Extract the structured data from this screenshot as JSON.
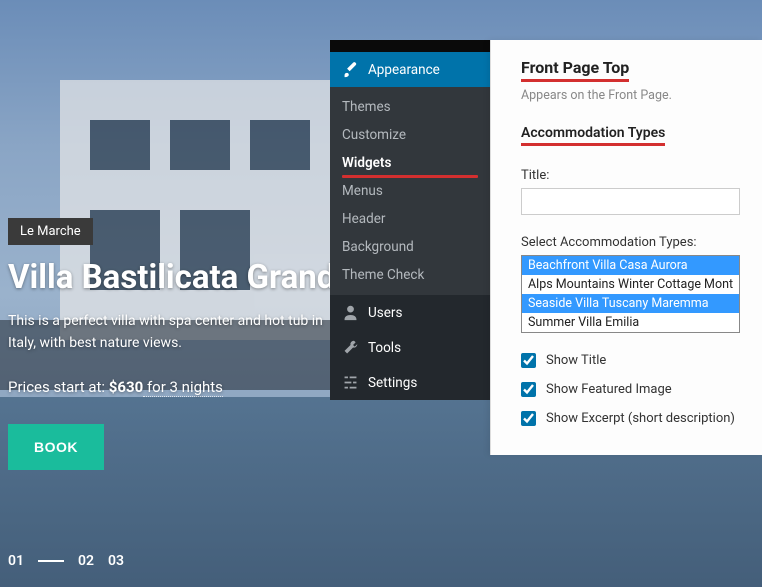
{
  "slider": {
    "tag": "Le Marche",
    "title": "Villa Bastilicata Grande",
    "description": "This is a perfect villa with spa center and hot tub in Italy, with best nature views.",
    "price_prefix": "Prices start at: ",
    "price_amount": "$630",
    "price_suffix": " for 3 nights",
    "book_label": "BOOK",
    "nav": [
      "01",
      "02",
      "03"
    ]
  },
  "admin": {
    "appearance": {
      "label": "Appearance",
      "items": [
        "Themes",
        "Customize",
        "Widgets",
        "Menus",
        "Header",
        "Background",
        "Theme Check"
      ],
      "active_index": 2
    },
    "users_label": "Users",
    "tools_label": "Tools",
    "settings_label": "Settings"
  },
  "widget": {
    "area_title": "Front Page Top",
    "area_desc": "Appears on the Front Page.",
    "widget_name": "Accommodation Types",
    "title_label": "Title:",
    "title_value": "",
    "select_label": "Select Accommodation Types:",
    "options": [
      {
        "label": "Beachfront Villa Casa Aurora",
        "selected": true
      },
      {
        "label": "Alps Mountains Winter Cottage Mont",
        "selected": false
      },
      {
        "label": "Seaside Villa Tuscany Maremma",
        "selected": true
      },
      {
        "label": "Summer Villa Emilia",
        "selected": false
      }
    ],
    "cb_title": "Show Title",
    "cb_image": "Show Featured Image",
    "cb_excerpt": "Show Excerpt (short description)"
  }
}
